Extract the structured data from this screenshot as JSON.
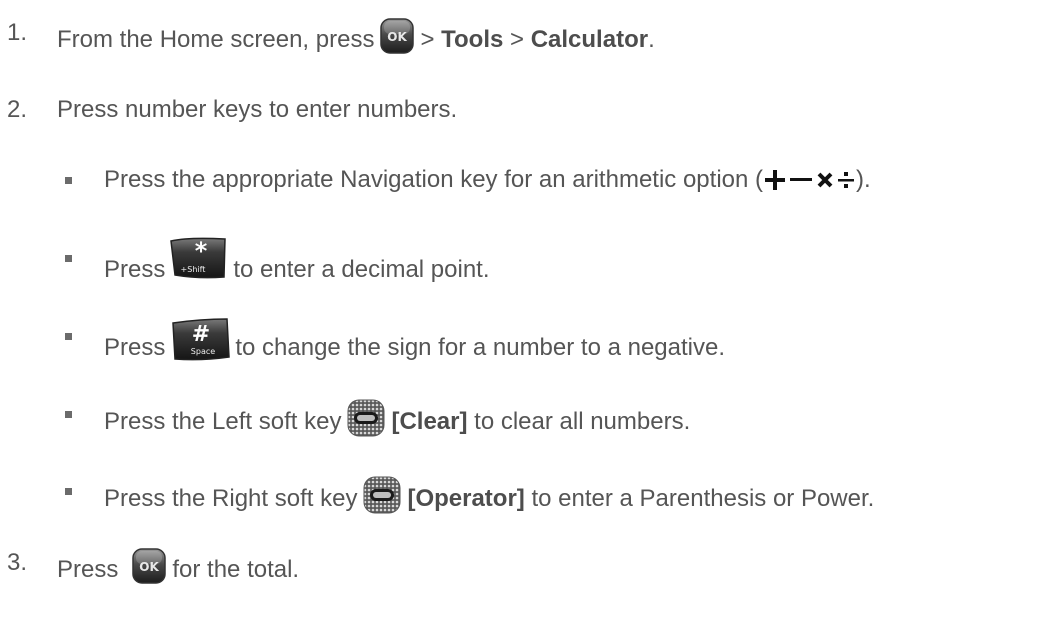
{
  "steps": [
    {
      "number": "1.",
      "pre": "From the Home screen, press",
      "sep1": ">",
      "bold1": "Tools",
      "sep2": ">",
      "bold2": "Calculator",
      "post": ".",
      "key_icon": "ok-key-icon",
      "key_label": "OK"
    },
    {
      "number": "2.",
      "text": "Press number keys to enter numbers."
    },
    {
      "number": "3.",
      "pre": "Press",
      "post": "for the total.",
      "key_icon": "ok-key-icon",
      "key_label": "OK"
    }
  ],
  "bullets": [
    {
      "pre": "Press the appropriate Navigation key for an arithmetic option (",
      "post": ").",
      "operators": [
        "plus-icon",
        "minus-icon",
        "multiply-icon",
        "divide-icon"
      ]
    },
    {
      "pre": "Press",
      "post": "to enter a decimal point.",
      "key_icon": "star-shift-key-icon",
      "key_label": "*",
      "key_sublabel": "+Shift"
    },
    {
      "pre": "Press",
      "post": "to change the sign for a number to a negative.",
      "key_icon": "pound-space-key-icon",
      "key_label": "#",
      "key_sublabel": "Space"
    },
    {
      "pre": "Press the Left soft key",
      "bold": "[Clear]",
      "post": "to clear all numbers.",
      "key_icon": "left-soft-key-icon"
    },
    {
      "pre": "Press the Right soft key",
      "bold": "[Operator]",
      "post": "to enter a Parenthesis or Power.",
      "key_icon": "right-soft-key-icon"
    }
  ],
  "colors": {
    "text": "#555555",
    "key_dark": "#2a2a2a",
    "key_light": "#8a8a8a"
  }
}
